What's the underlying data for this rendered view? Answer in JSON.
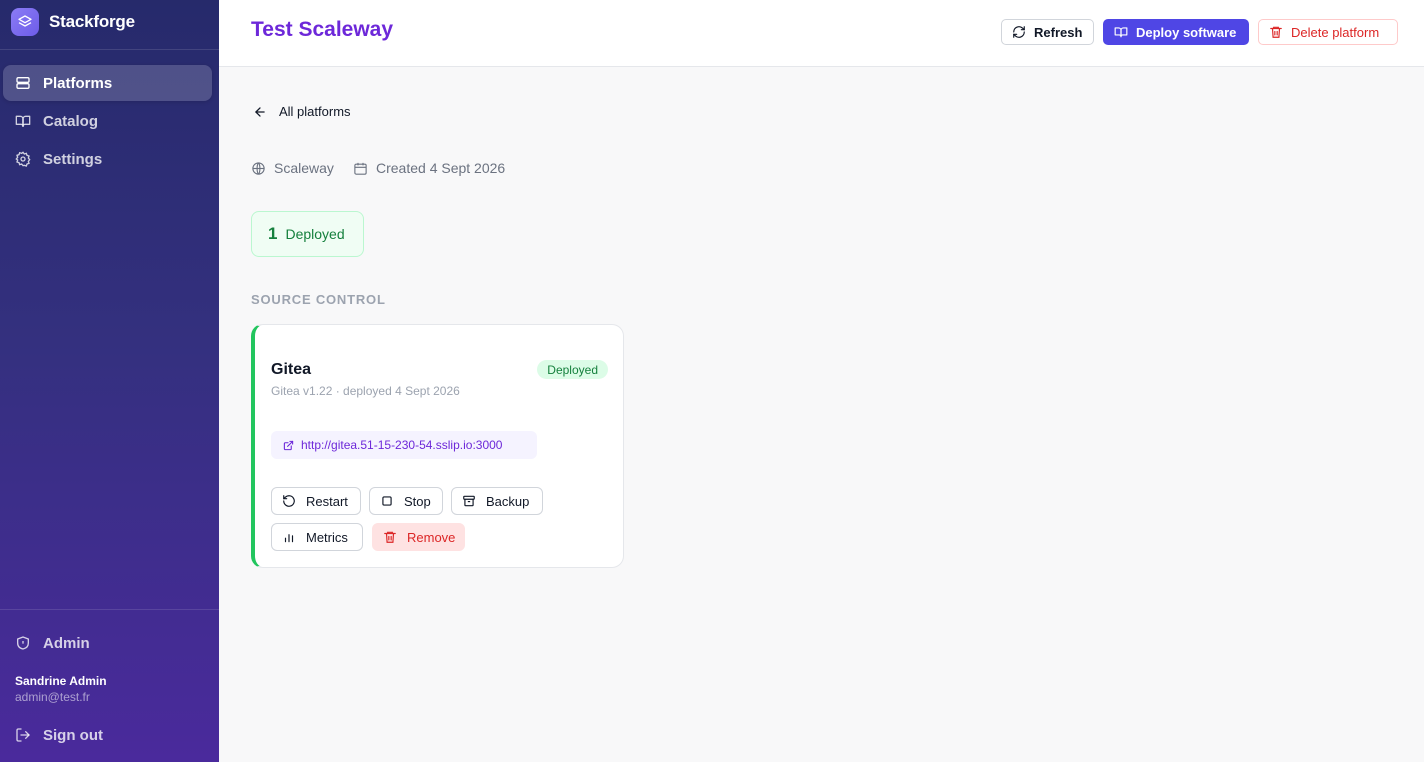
{
  "app": {
    "name": "Stackforge"
  },
  "sidebar": {
    "items": [
      {
        "label": "Platforms",
        "icon": "server-icon",
        "active": true
      },
      {
        "label": "Catalog",
        "icon": "book-icon",
        "active": false
      },
      {
        "label": "Settings",
        "icon": "gear-icon",
        "active": false
      }
    ],
    "admin_label": "Admin",
    "user": {
      "name": "Sandrine Admin",
      "email": "admin@test.fr"
    },
    "sign_out_label": "Sign out"
  },
  "header": {
    "title": "Test Scaleway",
    "refresh_label": "Refresh",
    "deploy_label": "Deploy software",
    "delete_label": "Delete platform"
  },
  "main": {
    "back_label": "All platforms",
    "provider": "Scaleway",
    "created": "Created 4 Sept 2026",
    "stats": {
      "count": "1",
      "label": "Deployed"
    },
    "section_title": "SOURCE CONTROL",
    "card": {
      "title": "Gitea",
      "subtitle": "Gitea v1.22 · deployed 4 Sept 2026",
      "status": "Deployed",
      "url": "http://gitea.51-15-230-54.sslip.io:3000",
      "actions": {
        "restart": "Restart",
        "stop": "Stop",
        "backup": "Backup",
        "metrics": "Metrics",
        "remove": "Remove"
      }
    }
  },
  "colors": {
    "accent": "#6d28d9",
    "primary_button": "#4f46e5",
    "danger": "#dc2626",
    "success": "#15803d"
  }
}
